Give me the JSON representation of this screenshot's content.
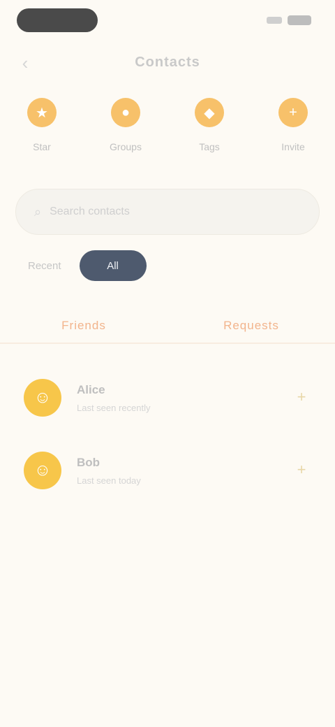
{
  "status_bar": {
    "time": ""
  },
  "nav": {
    "back_icon": "chevron-left-icon",
    "title": "Contacts"
  },
  "quick_actions": [
    {
      "icon": "star-icon",
      "label": "Star"
    },
    {
      "icon": "group-icon",
      "label": "Groups"
    },
    {
      "icon": "tag-icon",
      "label": "Tags"
    },
    {
      "icon": "add-icon",
      "label": "Invite"
    }
  ],
  "search": {
    "placeholder": "Search contacts"
  },
  "filters": [
    {
      "label": "Recent",
      "active": false
    },
    {
      "label": "All",
      "active": true
    }
  ],
  "segments": [
    {
      "label": "Friends"
    },
    {
      "label": "Requests"
    }
  ],
  "list": [
    {
      "avatar_icon": "user-icon",
      "name": "Alice",
      "desc": "Last seen recently",
      "action_icon": "plus-icon"
    },
    {
      "avatar_icon": "user-icon",
      "name": "Bob",
      "desc": "Last seen today",
      "action_icon": "plus-icon"
    }
  ],
  "colors": {
    "background": "#fdfaf4",
    "accent": "#f7c16a",
    "active_tab": "#4e5a6e",
    "segment_text": "#f2b48c",
    "avatar": "#f7c64a"
  }
}
